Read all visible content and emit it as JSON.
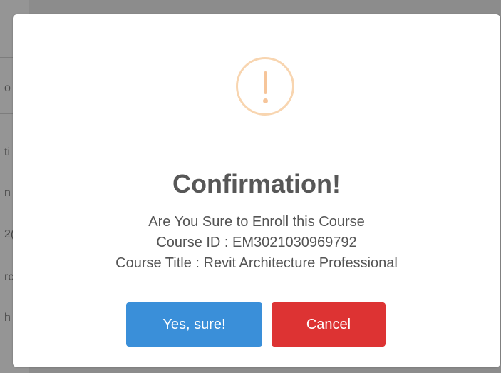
{
  "background": {
    "fragments": [
      "o",
      "ti",
      "n",
      "2(",
      "rc",
      "h"
    ]
  },
  "dialog": {
    "icon": "warning-exclamation-icon",
    "title": "Confirmation!",
    "message_lines": [
      "Are You Sure to Enroll this Course",
      "Course ID : EM3021030969792",
      "Course Title : Revit Architecture Professional"
    ],
    "confirm_label": "Yes, sure!",
    "cancel_label": "Cancel"
  },
  "colors": {
    "overlay": "#8c8c8c",
    "warning": "#f8bb86",
    "confirm": "#3a8fd9",
    "cancel": "#dd3333",
    "title_text": "#575757"
  }
}
